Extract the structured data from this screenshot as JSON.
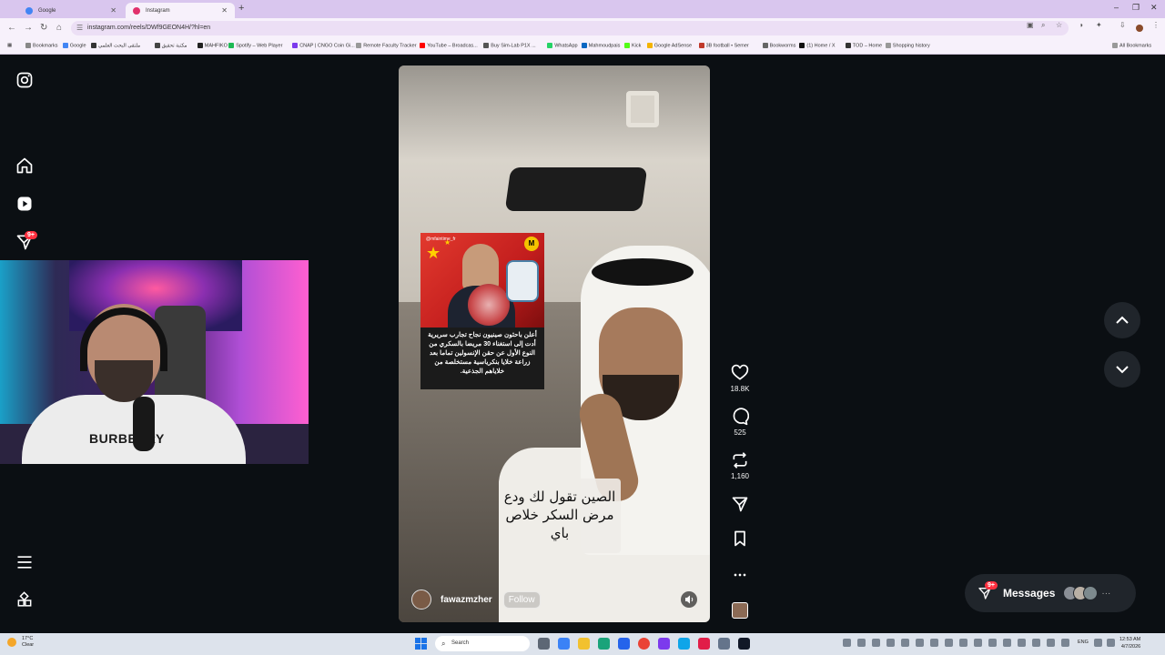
{
  "browser": {
    "tabs": [
      {
        "title": "Google",
        "active": false,
        "fav_color": "#4285f4"
      },
      {
        "title": "Instagram",
        "active": true,
        "fav_color": "#e1306c"
      }
    ],
    "url": "instagram.com/reels/DWf9GEON4H/?hl=en",
    "bookmarks": [
      "Bookmarks",
      "Google",
      "ملتقى البحث العلمي",
      "مكتبة تحقيق",
      "MAHFIKO",
      "Spotify – Web Player",
      "CNAP | CNGO Coin Gi...",
      "Remote Faculty Tracker",
      "YouTube – Broadcas...",
      "Buy Sim-Lab P1X ...",
      "WhatsApp",
      "Mahmoudpais",
      "Kick",
      "Google AdSense",
      "3B football • Semer",
      "Bookworms",
      "(1) Home / X",
      "TOD – Home",
      "Shopping history"
    ],
    "all_bookmarks": "All Bookmarks"
  },
  "sidebar": {
    "notifications_badge": "9+"
  },
  "webcam": {
    "shirt_text": "BURBERRY"
  },
  "reel": {
    "card_handle": "@mfaintime_fr",
    "card_text": "أعلن باحثون صينيون نجاح تجارب سريرية أدت إلى استغناء 30 مريضا بالسكري من النوع الأول عن حقن الإنسولين تماما بعد زراعة خلايا بنكرياسية مستخلصة من خلاياهم الجذعية.",
    "caption": "الصين تقول لك ودع مرض السكر خلاص باي",
    "username": "fawazmzher",
    "follow_label": "Follow",
    "likes": "18.8K",
    "comments": "525",
    "reposts": "1,160"
  },
  "messages": {
    "label": "Messages",
    "badge": "9+"
  },
  "taskbar": {
    "weather_temp": "17°C",
    "weather_desc": "Clear",
    "search_placeholder": "Search",
    "lang": "ENG",
    "time": "12:53 AM",
    "date": "4/7/2026"
  }
}
